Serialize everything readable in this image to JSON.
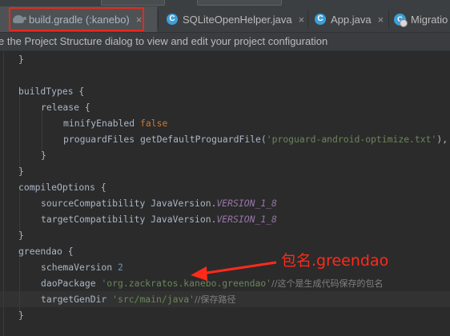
{
  "tabs": [
    {
      "label": "build.gradle (:kanebo)",
      "icon": "gradle-icon",
      "active": true
    },
    {
      "label": "SQLiteOpenHelper.java",
      "icon": "class-icon",
      "active": false
    },
    {
      "label": "App.java",
      "icon": "class-icon",
      "active": false
    },
    {
      "label": "Migratio",
      "icon": "class-icon",
      "active": false
    }
  ],
  "tab_close": "×",
  "banner": {
    "text": "e the Project Structure dialog to view and edit your project configuration"
  },
  "code": {
    "l0": "}",
    "l1_kw": "buildTypes",
    "l1_b": " {",
    "l2_kw": "release",
    "l2_b": " {",
    "l3_a": "minifyEnabled ",
    "l3_b": "false",
    "l4_a": "proguardFiles getDefaultProguardFile(",
    "l4_b": "'proguard-android-optimize.txt'",
    "l4_c": "), '",
    "l5": "}",
    "l6": "}",
    "l7_a": "compileOptions {",
    "l8_a": "sourceCompatibility JavaVersion.",
    "l8_b": "VERSION_1_8",
    "l9_a": "targetCompatibility JavaVersion.",
    "l9_b": "VERSION_1_8",
    "l10": "}",
    "l11": "greendao {",
    "l12_a": "schemaVersion ",
    "l12_b": "2",
    "l13_a": "daoPackage ",
    "l13_b": "'org.zackratos.kanebo.greendao'",
    "l13_c": "//这个是生成代码保存的包名",
    "l14_a": "targetGenDir ",
    "l14_b": "'src/main/java'",
    "l14_c": "//保存路径",
    "l15": "}"
  },
  "annotation": {
    "text": "包名.greendao",
    "color": "#ff2a1a"
  },
  "colors": {
    "keyword": "#cc7832",
    "string": "#6a8759",
    "number": "#6897bb",
    "constant": "#9876aa",
    "comment": "#808080",
    "highlight": "#e8281d"
  }
}
